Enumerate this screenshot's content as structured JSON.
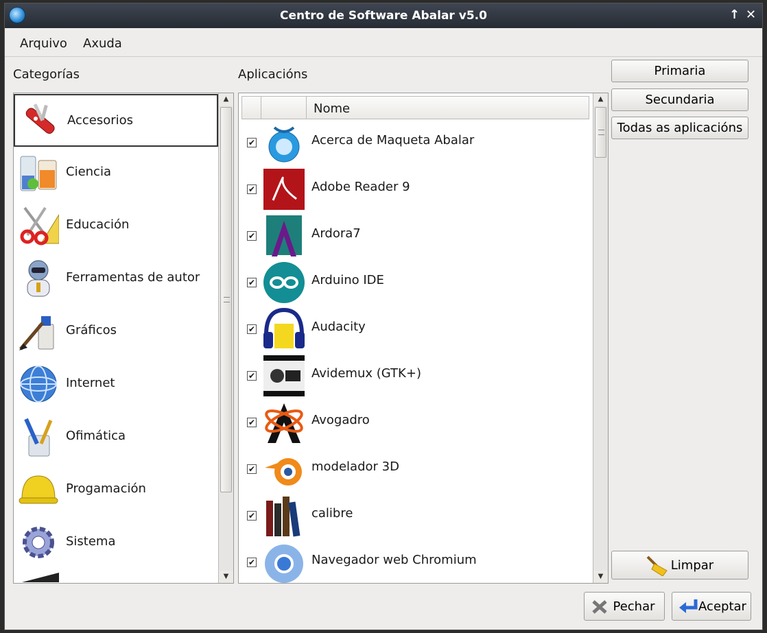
{
  "window": {
    "title": "Centro de Software Abalar v5.0"
  },
  "menu": [
    {
      "label": "Arquivo"
    },
    {
      "label": "Axuda"
    }
  ],
  "categories": {
    "heading": "Categorías",
    "items": [
      {
        "label": "Accesorios",
        "icon": "swiss-knife-icon",
        "selected": true
      },
      {
        "label": "Ciencia",
        "icon": "lab-flask-icon"
      },
      {
        "label": "Educación",
        "icon": "scissors-ruler-icon"
      },
      {
        "label": "Ferramentas de autor",
        "icon": "robot-icon"
      },
      {
        "label": "Gráficos",
        "icon": "paint-brush-icon"
      },
      {
        "label": "Internet",
        "icon": "globe-icon"
      },
      {
        "label": "Ofimática",
        "icon": "pencil-cup-icon"
      },
      {
        "label": "Progamación",
        "icon": "hard-hat-icon"
      },
      {
        "label": "Sistema",
        "icon": "gear-icon"
      }
    ]
  },
  "applications": {
    "heading": "Aplicacións",
    "column_name": "Nome",
    "items": [
      {
        "label": "Acerca de Maqueta Abalar",
        "icon": "abalar-icon",
        "checked": true
      },
      {
        "label": "Adobe Reader 9",
        "icon": "adobe-reader-icon",
        "checked": true
      },
      {
        "label": "Ardora7",
        "icon": "ardora-icon",
        "checked": true
      },
      {
        "label": "Arduino IDE",
        "icon": "arduino-icon",
        "checked": true
      },
      {
        "label": "Audacity",
        "icon": "audacity-icon",
        "checked": true
      },
      {
        "label": "Avidemux (GTK+)",
        "icon": "avidemux-icon",
        "checked": true
      },
      {
        "label": "Avogadro",
        "icon": "avogadro-icon",
        "checked": true
      },
      {
        "label": "modelador 3D",
        "icon": "blender-icon",
        "checked": true
      },
      {
        "label": "calibre",
        "icon": "calibre-icon",
        "checked": true
      },
      {
        "label": "Navegador web Chromium",
        "icon": "chromium-icon",
        "checked": true
      }
    ]
  },
  "filters": {
    "primary": "Primaria",
    "secondary": "Secundaria",
    "all": "Todas as aplicacións"
  },
  "actions": {
    "clear": "Limpar",
    "close": "Pechar",
    "accept": "Aceptar"
  },
  "colors": {
    "titlebar": "#2f353f",
    "window_bg": "#eeedeb",
    "panel_bg": "#ffffff"
  }
}
